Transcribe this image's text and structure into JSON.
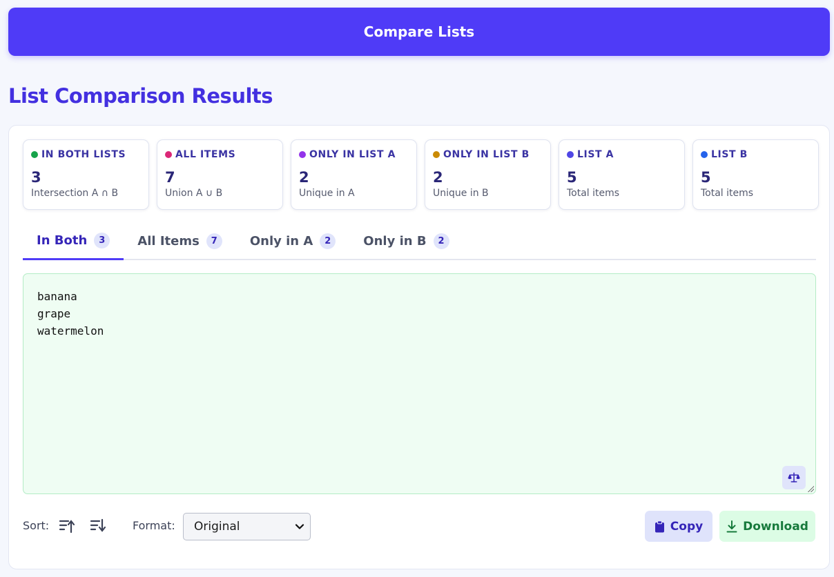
{
  "header": {
    "compare_label": "Compare Lists"
  },
  "page_title": "List Comparison Results",
  "stats": [
    {
      "label": "IN BOTH LISTS",
      "value": "3",
      "sub": "Intersection A ∩ B",
      "color": "#16a34a"
    },
    {
      "label": "ALL ITEMS",
      "value": "7",
      "sub": "Union A ∪ B",
      "color": "#db2777"
    },
    {
      "label": "ONLY IN LIST A",
      "value": "2",
      "sub": "Unique in A",
      "color": "#9333ea"
    },
    {
      "label": "ONLY IN LIST B",
      "value": "2",
      "sub": "Unique in B",
      "color": "#ca8a04"
    },
    {
      "label": "LIST A",
      "value": "5",
      "sub": "Total items",
      "color": "#4f46e5"
    },
    {
      "label": "LIST B",
      "value": "5",
      "sub": "Total items",
      "color": "#2563eb"
    }
  ],
  "tabs": [
    {
      "label": "In Both",
      "count": "3",
      "active": true
    },
    {
      "label": "All Items",
      "count": "7",
      "active": false
    },
    {
      "label": "Only in A",
      "count": "2",
      "active": false
    },
    {
      "label": "Only in B",
      "count": "2",
      "active": false
    }
  ],
  "results": {
    "lines": [
      "banana",
      "grape",
      "watermelon"
    ],
    "scale_icon": "scale-balance-icon"
  },
  "controls": {
    "sort_label": "Sort:",
    "sort_asc_icon": "sort-ascending-icon",
    "sort_desc_icon": "sort-descending-icon",
    "format_label": "Format:",
    "format_value": "Original",
    "copy_label": "Copy",
    "download_label": "Download"
  }
}
